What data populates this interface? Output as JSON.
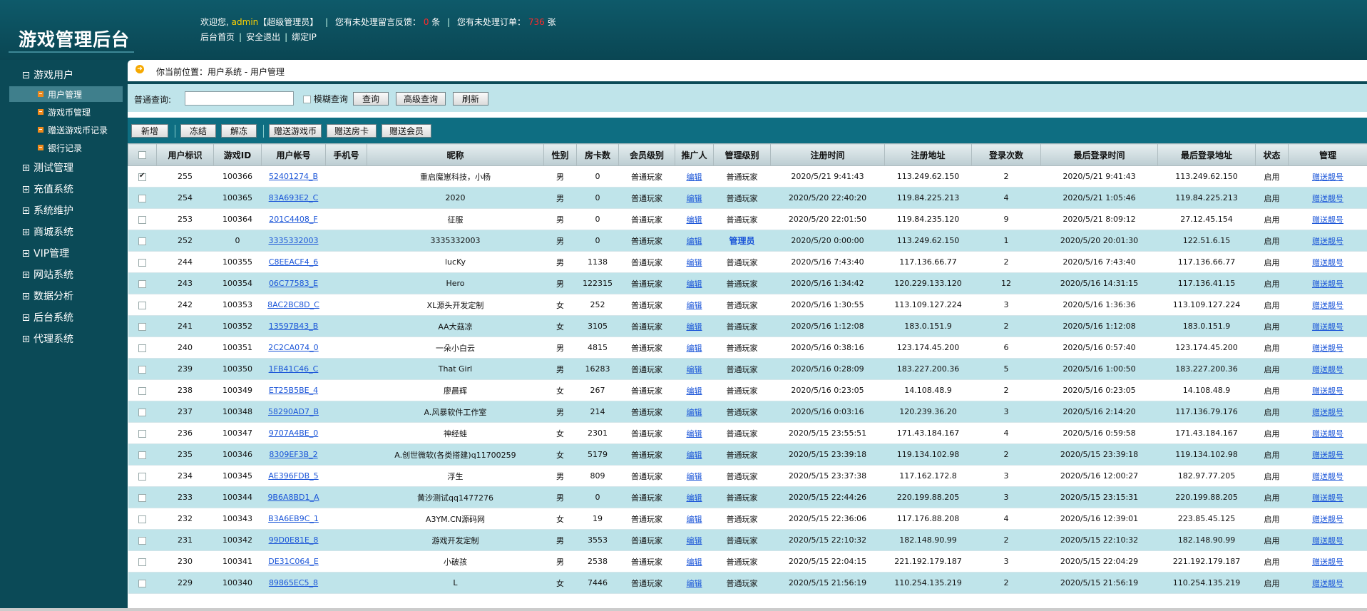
{
  "brand": "游戏管理后台",
  "header": {
    "welcome_prefix": "欢迎您,",
    "user": "admin",
    "role": "【超级管理员】",
    "feedback_text": "您有未处理留言反馈：",
    "feedback_count": "0",
    "feedback_unit": "条",
    "orders_text": "您有未处理订单：",
    "orders_count": "736",
    "orders_unit": "张",
    "links": [
      "后台首页",
      "安全退出",
      "绑定IP"
    ]
  },
  "sidebar": {
    "groups": [
      "游戏用户",
      "测试管理",
      "充值系统",
      "系统维护",
      "商城系统",
      "VIP管理",
      "网站系统",
      "数据分析",
      "后台系统",
      "代理系统"
    ],
    "subitems": [
      "用户管理",
      "游戏币管理",
      "赠送游戏币记录",
      "银行记录"
    ]
  },
  "breadcrumb": "你当前位置：用户系统 - 用户管理",
  "search": {
    "label": "普通查询:",
    "value": "",
    "fuzzy_label": "模糊查询",
    "buttons": [
      "查询",
      "高级查询",
      "刷新"
    ]
  },
  "toolbar": [
    "新增",
    "冻结",
    "解冻",
    "赠送游戏币",
    "赠送房卡",
    "赠送会员"
  ],
  "table": {
    "headers": [
      "",
      "用户标识",
      "游戏ID",
      "用户帐号",
      "手机号",
      "昵称",
      "性别",
      "房卡数",
      "会员级别",
      "推广人",
      "管理级别",
      "注册时间",
      "注册地址",
      "登录次数",
      "最后登录时间",
      "最后登录地址",
      "状态",
      "管理"
    ],
    "rows": [
      {
        "checked": true,
        "uid": "255",
        "gid": "100366",
        "account": "52401274_B",
        "phone": "",
        "nick": "重启魔崽科技，小杨",
        "sex": "男",
        "cards": "0",
        "level": "普通玩家",
        "promoter": "编辑",
        "admin": "普通玩家",
        "reg_time": "2020/5/21 9:41:43",
        "reg_ip": "113.249.62.150",
        "logins": "2",
        "last_time": "2020/5/21 9:41:43",
        "last_ip": "113.249.62.150",
        "status": "启用",
        "manage": "赠送靓号"
      },
      {
        "checked": false,
        "uid": "254",
        "gid": "100365",
        "account": "83A693E2_C",
        "phone": "",
        "nick": "2020",
        "sex": "男",
        "cards": "0",
        "level": "普通玩家",
        "promoter": "编辑",
        "admin": "普通玩家",
        "reg_time": "2020/5/20 22:40:20",
        "reg_ip": "119.84.225.213",
        "logins": "4",
        "last_time": "2020/5/21 1:05:46",
        "last_ip": "119.84.225.213",
        "status": "启用",
        "manage": "赠送靓号"
      },
      {
        "checked": false,
        "uid": "253",
        "gid": "100364",
        "account": "201C4408_F",
        "phone": "",
        "nick": "征服",
        "sex": "男",
        "cards": "0",
        "level": "普通玩家",
        "promoter": "编辑",
        "admin": "普通玩家",
        "reg_time": "2020/5/20 22:01:50",
        "reg_ip": "119.84.235.120",
        "logins": "9",
        "last_time": "2020/5/21 8:09:12",
        "last_ip": "27.12.45.154",
        "status": "启用",
        "manage": "赠送靓号"
      },
      {
        "checked": false,
        "uid": "252",
        "gid": "0",
        "account": "3335332003",
        "phone": "",
        "nick": "3335332003",
        "sex": "男",
        "cards": "0",
        "level": "普通玩家",
        "promoter": "编辑",
        "admin": "管理员",
        "admin_highlight": true,
        "reg_time": "2020/5/20 0:00:00",
        "reg_ip": "113.249.62.150",
        "logins": "1",
        "last_time": "2020/5/20 20:01:30",
        "last_ip": "122.51.6.15",
        "status": "启用",
        "manage": "赠送靓号"
      },
      {
        "checked": false,
        "uid": "244",
        "gid": "100355",
        "account": "C8EEACF4_6",
        "phone": "",
        "nick": "lucKy",
        "sex": "男",
        "cards": "1138",
        "level": "普通玩家",
        "promoter": "编辑",
        "admin": "普通玩家",
        "reg_time": "2020/5/16 7:43:40",
        "reg_ip": "117.136.66.77",
        "logins": "2",
        "last_time": "2020/5/16 7:43:40",
        "last_ip": "117.136.66.77",
        "status": "启用",
        "manage": "赠送靓号"
      },
      {
        "checked": false,
        "uid": "243",
        "gid": "100354",
        "account": "06C77583_E",
        "phone": "",
        "nick": "Hero",
        "sex": "男",
        "cards": "122315",
        "level": "普通玩家",
        "promoter": "编辑",
        "admin": "普通玩家",
        "reg_time": "2020/5/16 1:34:42",
        "reg_ip": "120.229.133.120",
        "logins": "12",
        "last_time": "2020/5/16 14:31:15",
        "last_ip": "117.136.41.15",
        "status": "启用",
        "manage": "赠送靓号"
      },
      {
        "checked": false,
        "uid": "242",
        "gid": "100353",
        "account": "8AC2BC8D_C",
        "phone": "",
        "nick": "XL源头开发定制",
        "sex": "女",
        "cards": "252",
        "level": "普通玩家",
        "promoter": "编辑",
        "admin": "普通玩家",
        "reg_time": "2020/5/16 1:30:55",
        "reg_ip": "113.109.127.224",
        "logins": "3",
        "last_time": "2020/5/16 1:36:36",
        "last_ip": "113.109.127.224",
        "status": "启用",
        "manage": "赠送靓号"
      },
      {
        "checked": false,
        "uid": "241",
        "gid": "100352",
        "account": "13597B43_B",
        "phone": "",
        "nick": "AA大菇凉",
        "sex": "女",
        "cards": "3105",
        "level": "普通玩家",
        "promoter": "编辑",
        "admin": "普通玩家",
        "reg_time": "2020/5/16 1:12:08",
        "reg_ip": "183.0.151.9",
        "logins": "2",
        "last_time": "2020/5/16 1:12:08",
        "last_ip": "183.0.151.9",
        "status": "启用",
        "manage": "赠送靓号"
      },
      {
        "checked": false,
        "uid": "240",
        "gid": "100351",
        "account": "2C2CA074_0",
        "phone": "",
        "nick": "一朵小白云",
        "sex": "男",
        "cards": "4815",
        "level": "普通玩家",
        "promoter": "编辑",
        "admin": "普通玩家",
        "reg_time": "2020/5/16 0:38:16",
        "reg_ip": "123.174.45.200",
        "logins": "6",
        "last_time": "2020/5/16 0:57:40",
        "last_ip": "123.174.45.200",
        "status": "启用",
        "manage": "赠送靓号"
      },
      {
        "checked": false,
        "uid": "239",
        "gid": "100350",
        "account": "1FB41C46_C",
        "phone": "",
        "nick": "That Girl",
        "sex": "男",
        "cards": "16283",
        "level": "普通玩家",
        "promoter": "编辑",
        "admin": "普通玩家",
        "reg_time": "2020/5/16 0:28:09",
        "reg_ip": "183.227.200.36",
        "logins": "5",
        "last_time": "2020/5/16 1:00:50",
        "last_ip": "183.227.200.36",
        "status": "启用",
        "manage": "赠送靓号"
      },
      {
        "checked": false,
        "uid": "238",
        "gid": "100349",
        "account": "ET25B5BE_4",
        "phone": "",
        "nick": "廖晨辉",
        "sex": "女",
        "cards": "267",
        "level": "普通玩家",
        "promoter": "编辑",
        "admin": "普通玩家",
        "reg_time": "2020/5/16 0:23:05",
        "reg_ip": "14.108.48.9",
        "logins": "2",
        "last_time": "2020/5/16 0:23:05",
        "last_ip": "14.108.48.9",
        "status": "启用",
        "manage": "赠送靓号"
      },
      {
        "checked": false,
        "uid": "237",
        "gid": "100348",
        "account": "58290AD7_B",
        "phone": "",
        "nick": "A.风暴软件工作室",
        "sex": "男",
        "cards": "214",
        "level": "普通玩家",
        "promoter": "编辑",
        "admin": "普通玩家",
        "reg_time": "2020/5/16 0:03:16",
        "reg_ip": "120.239.36.20",
        "logins": "3",
        "last_time": "2020/5/16 2:14:20",
        "last_ip": "117.136.79.176",
        "status": "启用",
        "manage": "赠送靓号"
      },
      {
        "checked": false,
        "uid": "236",
        "gid": "100347",
        "account": "9707A4BE_0",
        "phone": "",
        "nick": "神经蛙",
        "sex": "女",
        "cards": "2301",
        "level": "普通玩家",
        "promoter": "编辑",
        "admin": "普通玩家",
        "reg_time": "2020/5/15 23:55:51",
        "reg_ip": "171.43.184.167",
        "logins": "4",
        "last_time": "2020/5/16 0:59:58",
        "last_ip": "171.43.184.167",
        "status": "启用",
        "manage": "赠送靓号"
      },
      {
        "checked": false,
        "uid": "235",
        "gid": "100346",
        "account": "8309EF3B_2",
        "phone": "",
        "nick": "A.创世微软(各类搭建)q11700259",
        "sex": "女",
        "cards": "5179",
        "level": "普通玩家",
        "promoter": "编辑",
        "admin": "普通玩家",
        "reg_time": "2020/5/15 23:39:18",
        "reg_ip": "119.134.102.98",
        "logins": "2",
        "last_time": "2020/5/15 23:39:18",
        "last_ip": "119.134.102.98",
        "status": "启用",
        "manage": "赠送靓号"
      },
      {
        "checked": false,
        "uid": "234",
        "gid": "100345",
        "account": "AE396FDB_5",
        "phone": "",
        "nick": "浮生",
        "sex": "男",
        "cards": "809",
        "level": "普通玩家",
        "promoter": "编辑",
        "admin": "普通玩家",
        "reg_time": "2020/5/15 23:37:38",
        "reg_ip": "117.162.172.8",
        "logins": "3",
        "last_time": "2020/5/16 12:00:27",
        "last_ip": "182.97.77.205",
        "status": "启用",
        "manage": "赠送靓号"
      },
      {
        "checked": false,
        "uid": "233",
        "gid": "100344",
        "account": "9B6A8BD1_A",
        "phone": "",
        "nick": "黄沙测试qq1477276",
        "sex": "男",
        "cards": "0",
        "level": "普通玩家",
        "promoter": "编辑",
        "admin": "普通玩家",
        "reg_time": "2020/5/15 22:44:26",
        "reg_ip": "220.199.88.205",
        "logins": "3",
        "last_time": "2020/5/15 23:15:31",
        "last_ip": "220.199.88.205",
        "status": "启用",
        "manage": "赠送靓号"
      },
      {
        "checked": false,
        "uid": "232",
        "gid": "100343",
        "account": "B3A6EB9C_1",
        "phone": "",
        "nick": "A3YM.CN源码网",
        "sex": "女",
        "cards": "19",
        "level": "普通玩家",
        "promoter": "编辑",
        "admin": "普通玩家",
        "reg_time": "2020/5/15 22:36:06",
        "reg_ip": "117.176.88.208",
        "logins": "4",
        "last_time": "2020/5/16 12:39:01",
        "last_ip": "223.85.45.125",
        "status": "启用",
        "manage": "赠送靓号"
      },
      {
        "checked": false,
        "uid": "231",
        "gid": "100342",
        "account": "99D0E81E_8",
        "phone": "",
        "nick": "游戏开发定制",
        "sex": "男",
        "cards": "3553",
        "level": "普通玩家",
        "promoter": "编辑",
        "admin": "普通玩家",
        "reg_time": "2020/5/15 22:10:32",
        "reg_ip": "182.148.90.99",
        "logins": "2",
        "last_time": "2020/5/15 22:10:32",
        "last_ip": "182.148.90.99",
        "status": "启用",
        "manage": "赠送靓号"
      },
      {
        "checked": false,
        "uid": "230",
        "gid": "100341",
        "account": "DE31C064_E",
        "phone": "",
        "nick": "小破孩",
        "sex": "男",
        "cards": "2538",
        "level": "普通玩家",
        "promoter": "编辑",
        "admin": "普通玩家",
        "reg_time": "2020/5/15 22:04:15",
        "reg_ip": "221.192.179.187",
        "logins": "3",
        "last_time": "2020/5/15 22:04:29",
        "last_ip": "221.192.179.187",
        "status": "启用",
        "manage": "赠送靓号"
      },
      {
        "checked": false,
        "uid": "229",
        "gid": "100340",
        "account": "89865EC5_8",
        "phone": "",
        "nick": "L",
        "sex": "女",
        "cards": "7446",
        "level": "普通玩家",
        "promoter": "编辑",
        "admin": "普通玩家",
        "reg_time": "2020/5/15 21:56:19",
        "reg_ip": "110.254.135.219",
        "logins": "2",
        "last_time": "2020/5/15 21:56:19",
        "last_ip": "110.254.135.219",
        "status": "启用",
        "manage": "赠送靓号"
      }
    ]
  }
}
